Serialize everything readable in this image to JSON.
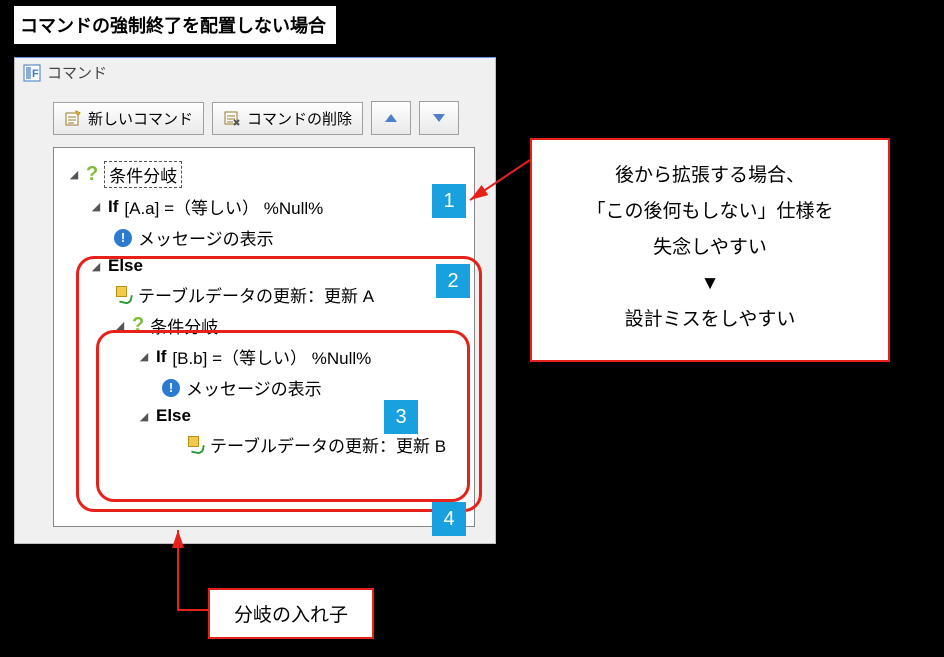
{
  "title": "コマンドの強制終了を配置しない場合",
  "panel": {
    "header": "コマンド",
    "toolbar": {
      "new_cmd": "新しいコマンド",
      "del_cmd": "コマンドの削除"
    }
  },
  "tree": {
    "root_label": "条件分岐",
    "if1_prefix": "If",
    "if1_expr": "[A.a] =（等しい） %Null%",
    "msg1": "メッセージの表示",
    "else1": "Else",
    "upd_a": "テーブルデータの更新：更新 A",
    "cond2": "条件分岐",
    "if2_prefix": "If",
    "if2_expr": "[B.b] =（等しい） %Null%",
    "msg2": "メッセージの表示",
    "else2": "Else",
    "upd_b": "テーブルデータの更新：更新 B"
  },
  "badges": {
    "b1": "1",
    "b2": "2",
    "b3": "3",
    "b4": "4"
  },
  "callout_main": {
    "line1": "後から拡張する場合、",
    "line2": "「この後何もしない」仕様を",
    "line3": "失念しやすい",
    "arrow": "▼",
    "line4": "設計ミスをしやすい"
  },
  "callout_nest": "分岐の入れ子"
}
